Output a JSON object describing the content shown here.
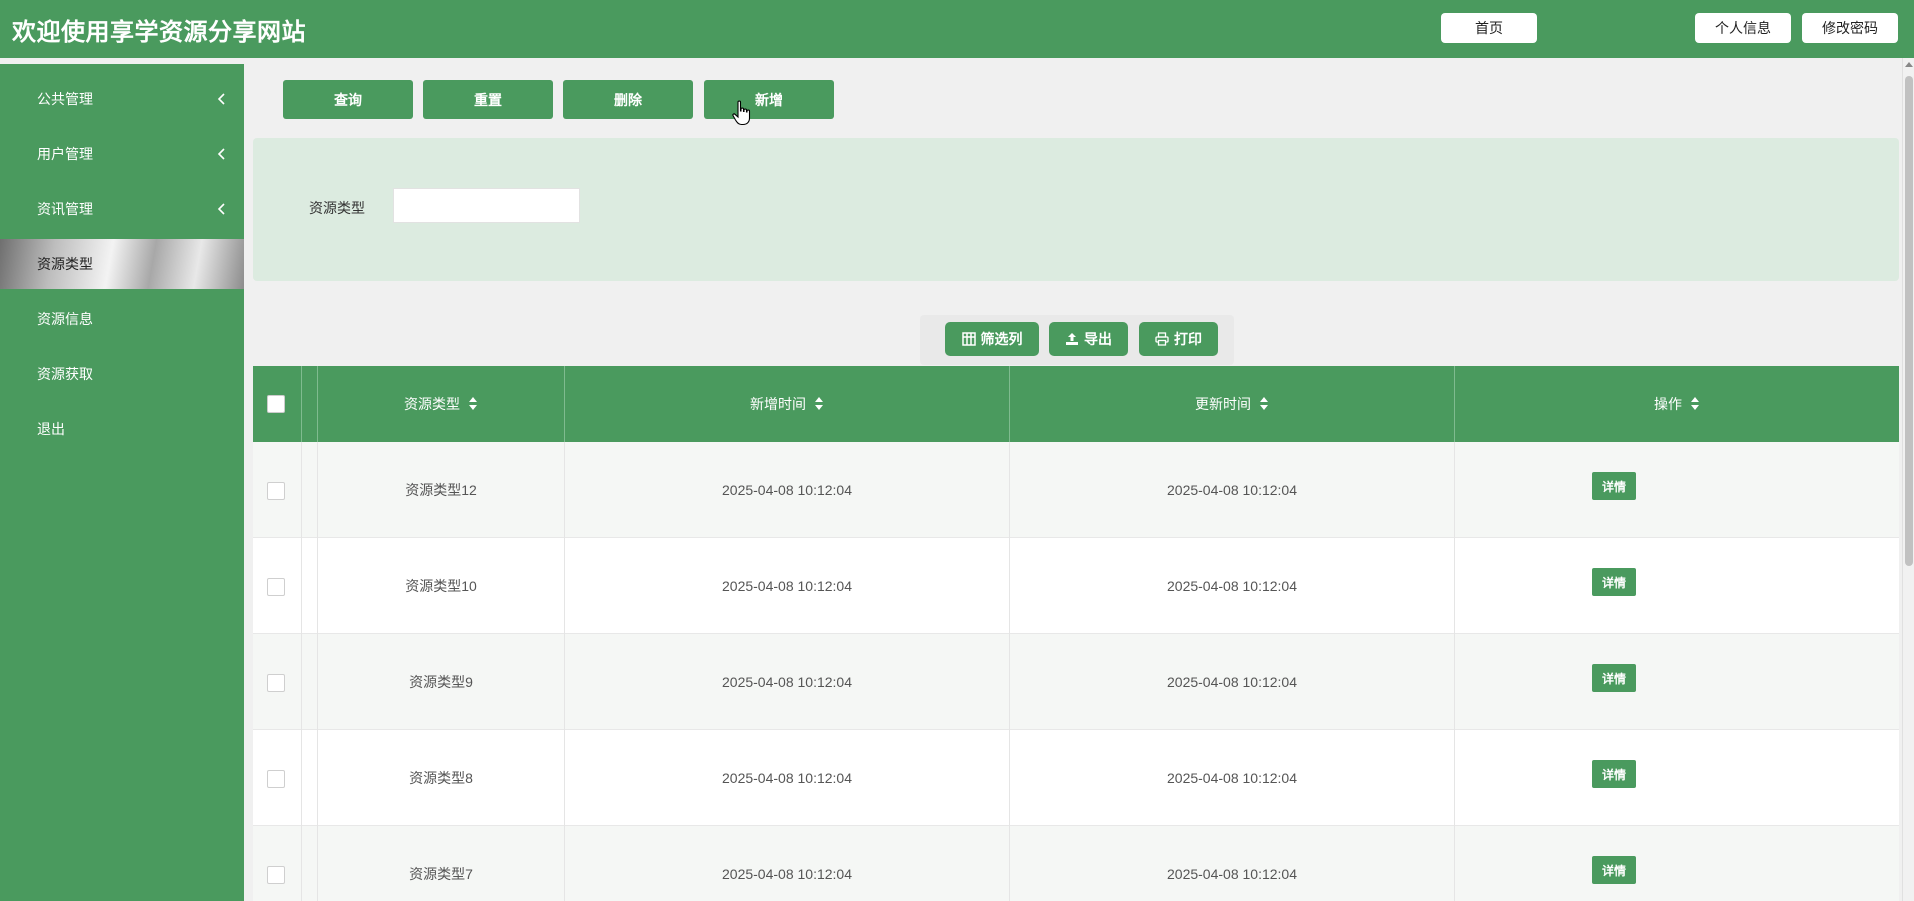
{
  "header": {
    "title": "欢迎使用享学资源分享网站",
    "home_label": "首页",
    "profile_label": "个人信息",
    "password_label": "修改密码"
  },
  "sidebar": {
    "items": [
      {
        "label": "公共管理",
        "has_submenu": true
      },
      {
        "label": "用户管理",
        "has_submenu": true
      },
      {
        "label": "资讯管理",
        "has_submenu": true
      },
      {
        "label": "资源类型",
        "active": true
      },
      {
        "label": "资源信息"
      },
      {
        "label": "资源获取"
      },
      {
        "label": "退出"
      }
    ]
  },
  "toolbar": {
    "query_label": "查询",
    "reset_label": "重置",
    "delete_label": "删除",
    "add_label": "新增"
  },
  "search": {
    "label": "资源类型",
    "value": "",
    "placeholder": ""
  },
  "table_tools": {
    "filter_label": "筛选列",
    "export_label": "导出",
    "print_label": "打印"
  },
  "table": {
    "columns": [
      "资源类型",
      "新增时间",
      "更新时间",
      "操作"
    ],
    "rows": [
      {
        "type": "资源类型12",
        "created": "2025-04-08 10:12:04",
        "updated": "2025-04-08 10:12:04",
        "action": "详情"
      },
      {
        "type": "资源类型10",
        "created": "2025-04-08 10:12:04",
        "updated": "2025-04-08 10:12:04",
        "action": "详情"
      },
      {
        "type": "资源类型9",
        "created": "2025-04-08 10:12:04",
        "updated": "2025-04-08 10:12:04",
        "action": "详情"
      },
      {
        "type": "资源类型8",
        "created": "2025-04-08 10:12:04",
        "updated": "2025-04-08 10:12:04",
        "action": "详情"
      },
      {
        "type": "资源类型7",
        "created": "2025-04-08 10:12:04",
        "updated": "2025-04-08 10:12:04",
        "action": "详情"
      }
    ]
  },
  "colors": {
    "primary": "#4a9a5e",
    "search_panel_bg": "#dcebe0",
    "page_bg": "#f0f0f0"
  },
  "icons": {
    "sidebar_chevron": "chevron-left-icon",
    "filter": "columns-icon",
    "export": "export-icon",
    "print": "printer-icon",
    "sort": "sort-icon"
  }
}
